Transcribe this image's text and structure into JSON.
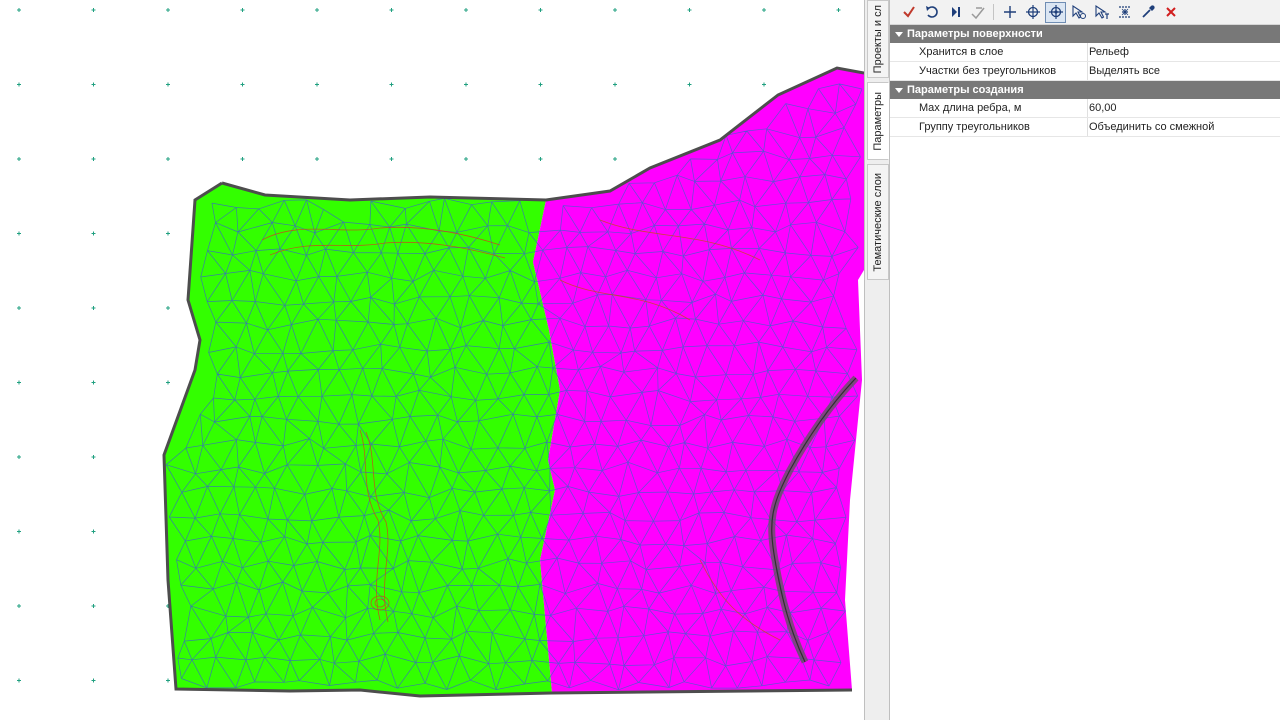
{
  "tabs": [
    {
      "label": "Проекты и сл",
      "active": false
    },
    {
      "label": "Параметры",
      "active": true
    },
    {
      "label": "Тематические слои",
      "active": false
    }
  ],
  "toolbar": {
    "buttons": [
      {
        "name": "apply-check-icon",
        "color": "#c0392b"
      },
      {
        "name": "undo-icon",
        "color": "#1f3f7a"
      },
      {
        "name": "step-forward-icon",
        "color": "#1f3f7a"
      },
      {
        "name": "edge-edit-icon",
        "color": "#9a9a9a"
      },
      {
        "name": "add-point-icon",
        "color": "#1f3f7a"
      },
      {
        "name": "capture-point-icon",
        "color": "#1f3f7a"
      },
      {
        "name": "snap-point-icon",
        "color": "#1f3f7a"
      },
      {
        "name": "select-objects-icon",
        "color": "#1f3f7a"
      },
      {
        "name": "select-text-icon",
        "color": "#1f3f7a"
      },
      {
        "name": "select-area-icon",
        "color": "#1f3f7a"
      },
      {
        "name": "eyedropper-icon",
        "color": "#1f3f7a"
      },
      {
        "name": "cancel-icon",
        "color": "#d21f1f"
      }
    ]
  },
  "sections": [
    {
      "title": "Параметры поверхности",
      "rows": [
        {
          "name": "Хранится в слое",
          "value": "Рельеф"
        },
        {
          "name": "Участки без треугольников",
          "value": "Выделять все"
        }
      ]
    },
    {
      "title": "Параметры создания",
      "rows": [
        {
          "name": "Max длина ребра, м",
          "value": "60,00"
        },
        {
          "name": "Группу треугольников",
          "value": "Объединить со смежной"
        }
      ]
    }
  ],
  "colors": {
    "region_green": "#33ff00",
    "region_magenta": "#ff00ff",
    "mesh_edge": "#3a64c8",
    "contour_line": "#c84a1e",
    "boundary": "#4d4d4d",
    "grid_marker": "#20a080",
    "section_header": "#787878"
  },
  "canvas": {
    "content": "TIN surface triangulation, two regions"
  }
}
